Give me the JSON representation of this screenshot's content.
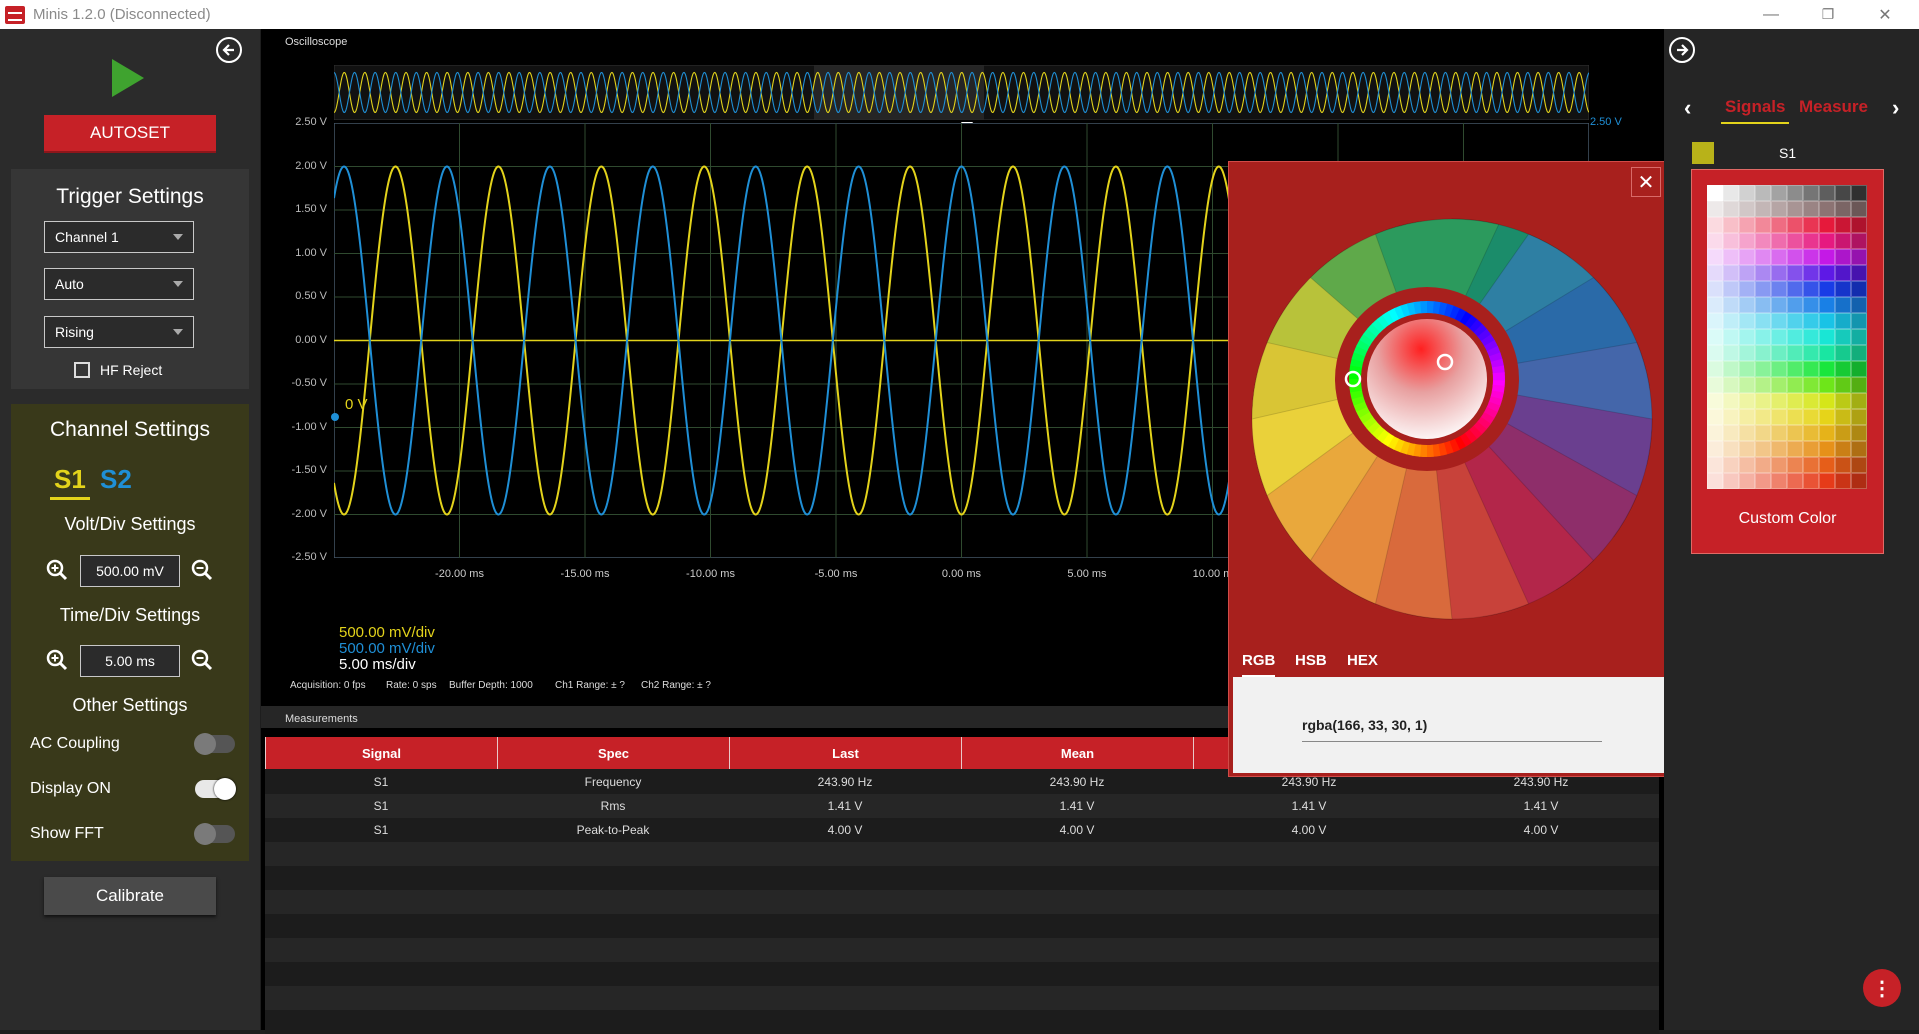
{
  "window": {
    "title": "Minis 1.2.0 (Disconnected)",
    "minimize": "—",
    "restore": "❐",
    "close": "✕"
  },
  "left": {
    "back_icon": "arrow-left-circle",
    "autoset_label": "AUTOSET",
    "trigger": {
      "title": "Trigger Settings",
      "channel": "Channel 1",
      "mode": "Auto",
      "edge": "Rising",
      "hf_reject_label": "HF Reject",
      "hf_reject_checked": false
    },
    "channel": {
      "title": "Channel Settings",
      "tab_s1": "S1",
      "tab_s2": "S2",
      "volt_div_title": "Volt/Div Settings",
      "volt_div_value": "500.00 mV",
      "time_div_title": "Time/Div Settings",
      "time_div_value": "5.00 ms",
      "other_title": "Other Settings",
      "ac_coupling_label": "AC Coupling",
      "ac_coupling_on": false,
      "display_label": "Display ON",
      "display_on": true,
      "fft_label": "Show FFT",
      "fft_on": false
    },
    "calibrate_label": "Calibrate"
  },
  "scope": {
    "title": "Oscilloscope",
    "y_ticks": [
      "2.50 V",
      "2.00 V",
      "1.50 V",
      "1.00 V",
      "0.50 V",
      "0.00 V",
      "-0.50 V",
      "-1.00 V",
      "-1.50 V",
      "-2.00 V",
      "-2.50 V"
    ],
    "y_right_label": "2.50 V",
    "zero_marker": "0 V",
    "x_ticks": [
      "-20.00 ms",
      "-15.00 ms",
      "-10.00 ms",
      "-5.00 ms",
      "0.00 ms",
      "5.00 ms",
      "10.00 m"
    ],
    "ch1_div": "500.00 mV/div",
    "ch2_div": "500.00 mV/div",
    "time_div": "5.00 ms/div",
    "status": {
      "acquisition": "Acquisition: 0 fps",
      "rate": "Rate: 0 sps",
      "buffer": "Buffer Depth: 1000",
      "ch1_range": "Ch1 Range: ± ?",
      "ch2_range": "Ch2 Range: ± ?"
    },
    "colors": {
      "ch1": "#e3d31b",
      "ch2": "#1f8fd6",
      "grid": "#2f4a2f"
    },
    "signal": {
      "ch1_amplitude_v": 2.0,
      "ch2_amplitude_v": 2.0,
      "frequency_hz": 243.9
    }
  },
  "measurements": {
    "title": "Measurements",
    "columns": [
      "Signal",
      "Spec",
      "Last",
      "Mean",
      "",
      ""
    ],
    "rows": [
      [
        "S1",
        "Frequency",
        "243.90 Hz",
        "243.90 Hz",
        "243.90 Hz",
        "243.90 Hz"
      ],
      [
        "S1",
        "Rms",
        "1.41 V",
        "1.41 V",
        "1.41 V",
        "1.41 V"
      ],
      [
        "S1",
        "Peak-to-Peak",
        "4.00 V",
        "4.00 V",
        "4.00 V",
        "4.00 V"
      ]
    ]
  },
  "picker": {
    "close_icon": "close-x",
    "tabs": [
      "RGB",
      "HSB",
      "HEX"
    ],
    "value": "rgba(166, 33, 30, 1)"
  },
  "right": {
    "forward_icon": "arrow-right-circle",
    "tab_signals": "Signals",
    "tab_measure": "Measure",
    "signal_name": "S1",
    "custom_color_label": "Custom Color",
    "more_icon": "vertical-dots"
  }
}
